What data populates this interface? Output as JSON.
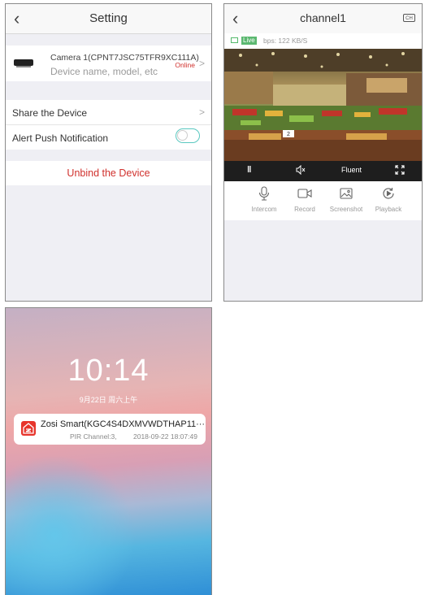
{
  "setting_screen": {
    "title": "Setting",
    "device": {
      "name": "Camera 1(CPNT7JSC75TFR9XC111A)",
      "subtitle": "Device name, model, etc",
      "status": "Online"
    },
    "share_label": "Share the Device",
    "alert_label": "Alert Push Notification",
    "alert_enabled": false,
    "unbind_label": "Unbind the Device"
  },
  "channel_screen": {
    "title": "channel1",
    "ch_icon_label": "CH",
    "live_label": "Live",
    "bps_text": "bps: 122 KB/S",
    "quality_label": "Fluent",
    "tools": [
      {
        "label": "Intercom",
        "icon": "microphone-icon"
      },
      {
        "label": "Record",
        "icon": "video-camera-icon"
      },
      {
        "label": "Screenshot",
        "icon": "image-icon"
      },
      {
        "label": "Playback",
        "icon": "playback-icon"
      }
    ],
    "price_sign_text": "2"
  },
  "lock_screen": {
    "time": "10:14",
    "date": "9月22日 周六上午",
    "notification": {
      "title": "Zosi Smart(KGC4S4DXMVWDTHAP11···",
      "body": "PIR Channel:3,",
      "timestamp": "2018-09-22 18:07:49"
    }
  },
  "colors": {
    "accent_red": "#d0312d",
    "toggle_teal": "#5ac8c0",
    "live_green": "#5bb870",
    "app_icon_red": "#e7352c"
  }
}
